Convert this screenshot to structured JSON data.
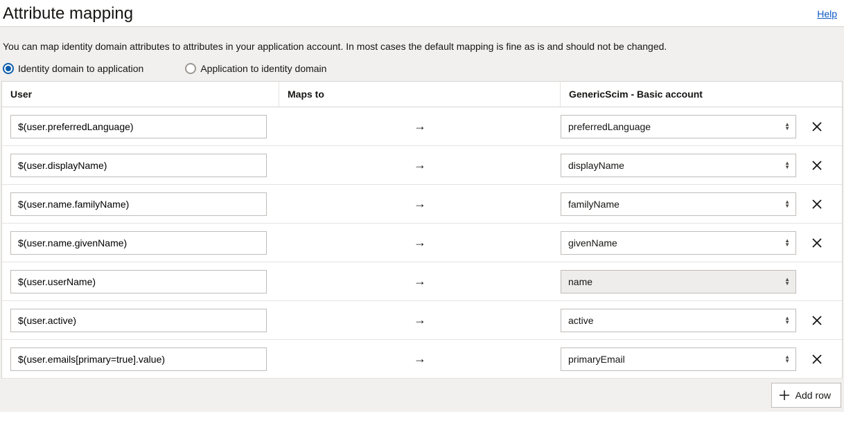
{
  "header": {
    "title": "Attribute mapping",
    "help_label": "Help"
  },
  "description": "You can map identity domain attributes to attributes in your application account. In most cases the default mapping is fine as is and should not be changed.",
  "direction": {
    "to_app_label": "Identity domain to application",
    "to_domain_label": "Application to identity domain",
    "selected": "to_app"
  },
  "columns": {
    "user": "User",
    "maps_to": "Maps to",
    "target": "GenericScim - Basic account"
  },
  "arrow_glyph": "→",
  "rows": [
    {
      "user_value": "$(user.preferredLanguage)",
      "target_value": "preferredLanguage",
      "target_disabled": false,
      "deletable": true
    },
    {
      "user_value": "$(user.displayName)",
      "target_value": "displayName",
      "target_disabled": false,
      "deletable": true
    },
    {
      "user_value": "$(user.name.familyName)",
      "target_value": "familyName",
      "target_disabled": false,
      "deletable": true
    },
    {
      "user_value": "$(user.name.givenName)",
      "target_value": "givenName",
      "target_disabled": false,
      "deletable": true
    },
    {
      "user_value": "$(user.userName)",
      "target_value": "name",
      "target_disabled": true,
      "deletable": false
    },
    {
      "user_value": "$(user.active)",
      "target_value": "active",
      "target_disabled": false,
      "deletable": true
    },
    {
      "user_value": "$(user.emails[primary=true].value)",
      "target_value": "primaryEmail",
      "target_disabled": false,
      "deletable": true
    }
  ],
  "footer": {
    "add_row_label": "Add row"
  }
}
